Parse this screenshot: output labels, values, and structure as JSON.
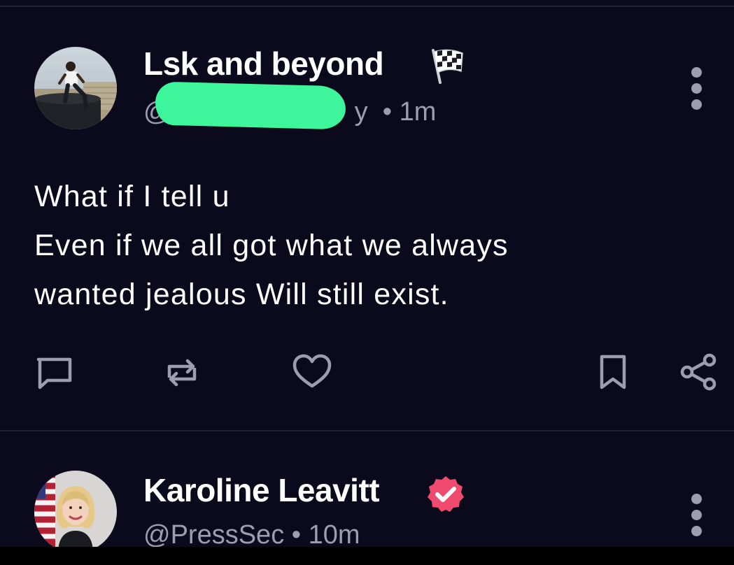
{
  "posts": [
    {
      "display_name": "Lsk and beyond",
      "badge_icon": "checkered-flag-icon",
      "handle_prefix": "@",
      "handle_suffix": "y",
      "time": "1m",
      "text_lines": [
        "What if I tell u",
        "Even if we all got what we always",
        "wanted jealous Will still exist."
      ],
      "actions": [
        "reply-icon",
        "repost-icon",
        "heart-icon",
        "bookmark-icon",
        "share-icon"
      ]
    },
    {
      "display_name": "Karoline Leavitt",
      "badge_icon": "verified-badge-icon",
      "handle": "@PressSec",
      "time": "10m"
    }
  ],
  "colors": {
    "background": "#0b0a1c",
    "muted_text": "#9e9cb0",
    "redaction": "#3df59b",
    "verified_badge": "#f04a6e"
  }
}
